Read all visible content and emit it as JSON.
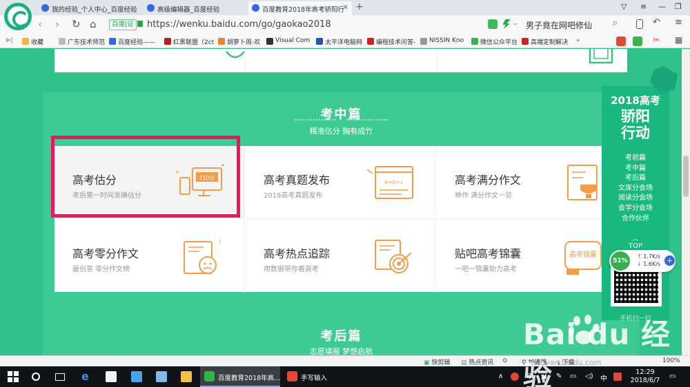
{
  "browser": {
    "tabs": [
      {
        "label": "我的经验_个人中心_百度经验",
        "active": false
      },
      {
        "label": "高级编辑器_百度经验",
        "active": false
      },
      {
        "label": "百度教育2018年高考骄阳行",
        "active": true
      }
    ],
    "new_tab": "+",
    "url_badge": "百度|证",
    "url": "https://wenku.baidu.com/go/gaokao2018",
    "search_text": "男子竟在网吧修仙",
    "colors": {
      "accent": "#1bb07a",
      "tab_strip": "#dfe5ea"
    }
  },
  "bookmarks": [
    {
      "label": "收藏",
      "color": "#f2b632"
    },
    {
      "label": "广东技术师范",
      "color": "#999999"
    },
    {
      "label": "百度经验——",
      "color": "#3468e0"
    },
    {
      "label": "红黑联盟（2ct",
      "color": "#b02020"
    },
    {
      "label": "胡萝卜周-欢",
      "color": "#e08a2e"
    },
    {
      "label": "Visual Com",
      "color": "#333333"
    },
    {
      "label": "太平洋电脑网",
      "color": "#2a4fb0"
    },
    {
      "label": "编程技术问答-",
      "color": "#cc2222"
    },
    {
      "label": "NISSIN Kno",
      "color": "#999999"
    },
    {
      "label": "微信公众平台",
      "color": "#3bb34a"
    },
    {
      "label": "高端定制解决",
      "color": "#cc2222"
    }
  ],
  "page": {
    "section_title": "考中篇",
    "section_sub": "精准估分 胸有成竹",
    "cards": [
      {
        "title": "高考估分",
        "sub": "考后第一时间准确估分",
        "icon": "score-estimate-icon",
        "badge": "710分"
      },
      {
        "title": "高考真题发布",
        "sub": "2018高考真题发布",
        "icon": "exam-paper-icon",
        "badge": "a+b=c"
      },
      {
        "title": "高考满分作文",
        "sub": "神作 满分作文一览",
        "icon": "trophy-essay-icon",
        "badge": ""
      },
      {
        "title": "高考零分作文",
        "sub": "最创意 零分作文榜",
        "icon": "sad-face-icon",
        "badge": ""
      },
      {
        "title": "高考热点追踪",
        "sub": "用数据带你看高考",
        "icon": "target-icon",
        "badge": ""
      },
      {
        "title": "贴吧高考锦囊",
        "sub": "一吧一锦囊助力高考",
        "icon": "tieba-bag-icon",
        "badge": "高考锦囊"
      }
    ],
    "section2_title": "考后篇",
    "section2_sub": "志愿填报 梦想启航",
    "colors": {
      "bg": "#2fc28a",
      "section": "#3ecb93",
      "highlight": "#e8185e",
      "illustration": "#f39c4a"
    }
  },
  "side_panel": {
    "year": "2018高考",
    "big_title_1": "骄阳",
    "big_title_2": "行动",
    "links": [
      "考前篇",
      "考中篇",
      "考后篇",
      "文库分会场",
      "阅读分会场",
      "会学分会场",
      "合作伙伴"
    ],
    "top_label": "TOP",
    "qr_caption": "手机扫一扫"
  },
  "net_widget": {
    "percent": "51%",
    "up": "1.7K/s",
    "down": "1.6K/s"
  },
  "watermark": {
    "text": "Bai du 经验",
    "sub": "jingyan.baidu.com"
  },
  "statusbar": {
    "items": [
      "快剪辑",
      "热点资讯",
      "加速器",
      "下载"
    ],
    "zoom": "100%"
  },
  "taskbar": {
    "apps": [
      {
        "label": "百度教育2018年高...",
        "active": true,
        "color": "#35b34a"
      },
      {
        "label": "手写输入",
        "active": false,
        "color": "#e0483a"
      }
    ],
    "tray_ime": "中",
    "time": "12:29",
    "date": "2018/6/7"
  }
}
